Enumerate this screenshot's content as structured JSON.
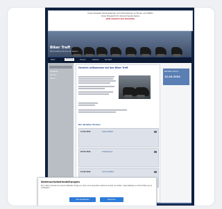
{
  "notice": {
    "line1": "Unser aktueller Terminkalender und Informationen zu Touren und Treffen",
    "line2": "Unser Programm für die kommende Saison",
    "line3": "jetzt ansehen und anmelden"
  },
  "brand": {
    "name": "Biker Treff",
    "tagline": "Motorradfreunde aus der Region"
  },
  "nav": [
    "Start",
    "Termine",
    "Touren",
    "Galerie",
    "Kontakt"
  ],
  "sidebar": {
    "links": [
      "Startseite",
      "Termine",
      "Touren",
      "Galerie",
      "Kontakt"
    ]
  },
  "main": {
    "heading": "Herzlich willkommen bei den Biker Treff",
    "section_title": "Die nächsten Termine",
    "events": [
      {
        "date": "12.04.2024",
        "name": "Saisonauftakt"
      },
      {
        "date": "05.05.2024",
        "name": "Frühjahrstour"
      },
      {
        "date": "16.06.2024",
        "name": "Sommertreffen"
      }
    ]
  },
  "right": {
    "label": "Nächster Termin",
    "value": "12.04.2024"
  },
  "cookie": {
    "title": "Datenschutzeinstellungen",
    "body": "Wir nutzen Cookies auf unserer Website. Einige von ihnen sind essenziell, während andere uns helfen, diese Website und Ihre Erfahrung zu verbessern.",
    "accept": "Alle akzeptieren",
    "save": "Speichern"
  },
  "colors": {
    "accent": "#2d7bd8",
    "brand": "#10203e",
    "highlight": "#c0122c"
  }
}
